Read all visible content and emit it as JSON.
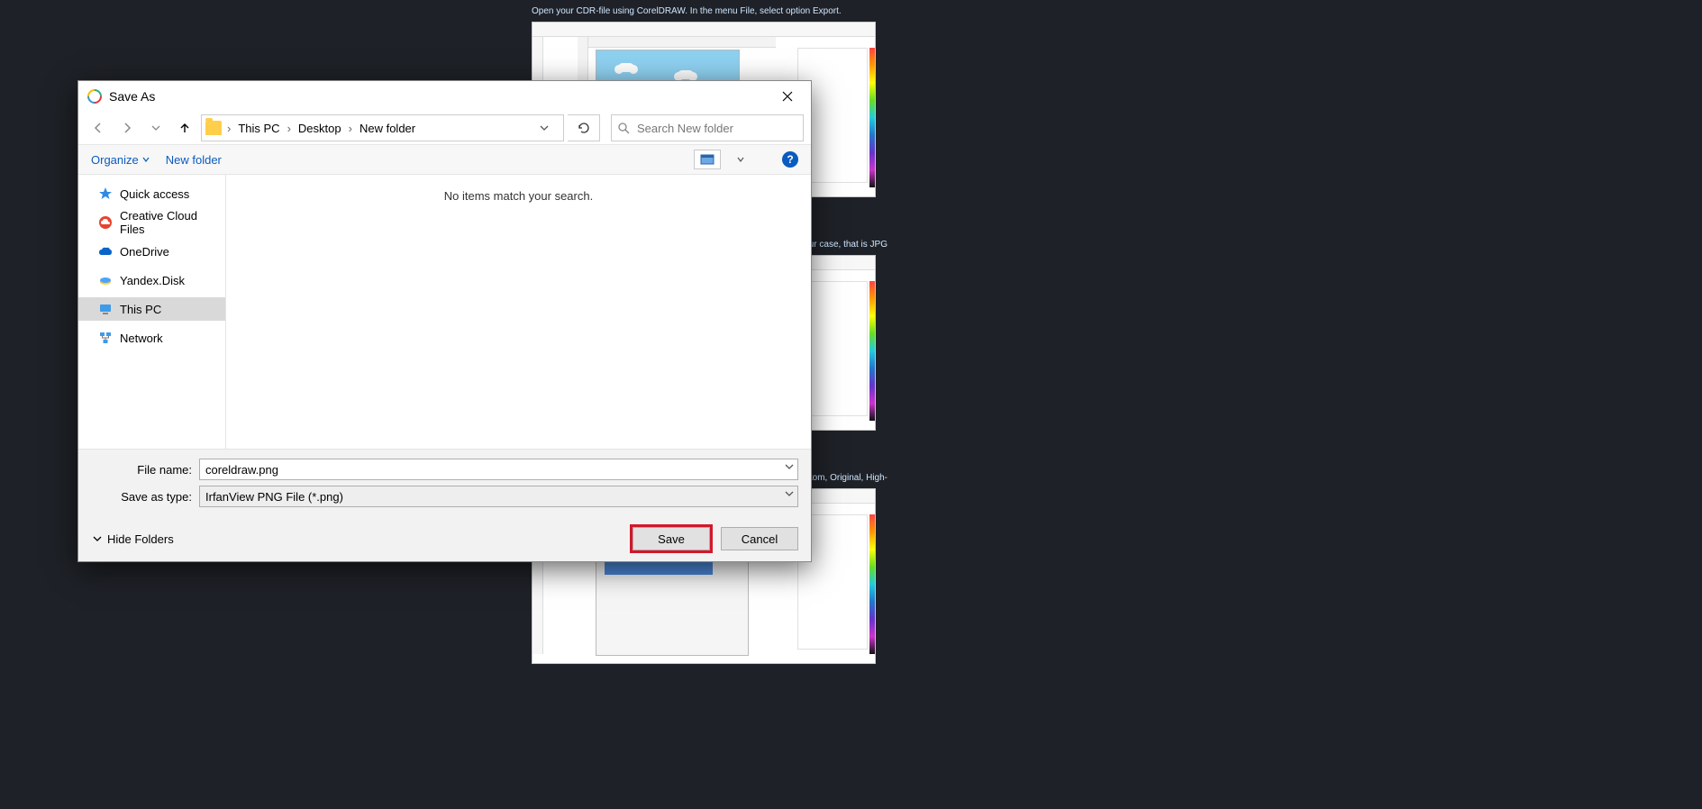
{
  "article": {
    "caption1": "Open your CDR-file using CorelDRAW. In the menu File, select option Export.",
    "caption2_trail": "at. In our case, that is JPG",
    "caption3_trail": "to Custom, Original, High-"
  },
  "dialog": {
    "title": "Save As",
    "breadcrumb": [
      "This PC",
      "Desktop",
      "New folder"
    ],
    "search_placeholder": "Search New folder",
    "toolbar": {
      "organize": "Organize",
      "new_folder": "New folder",
      "help": "?"
    },
    "sidebar": [
      {
        "key": "quick",
        "label": "Quick access"
      },
      {
        "key": "ccloud",
        "label": "Creative Cloud Files"
      },
      {
        "key": "onedrive",
        "label": "OneDrive"
      },
      {
        "key": "yandex",
        "label": "Yandex.Disk"
      },
      {
        "key": "thispc",
        "label": "This PC",
        "selected": true
      },
      {
        "key": "network",
        "label": "Network"
      }
    ],
    "empty_msg": "No items match your search.",
    "file_name_label": "File name:",
    "file_name_value": "coreldraw.png",
    "save_type_label": "Save as type:",
    "save_type_value": "IrfanView PNG File (*.png)",
    "hide_folders": "Hide Folders",
    "save_label": "Save",
    "cancel_label": "Cancel"
  }
}
